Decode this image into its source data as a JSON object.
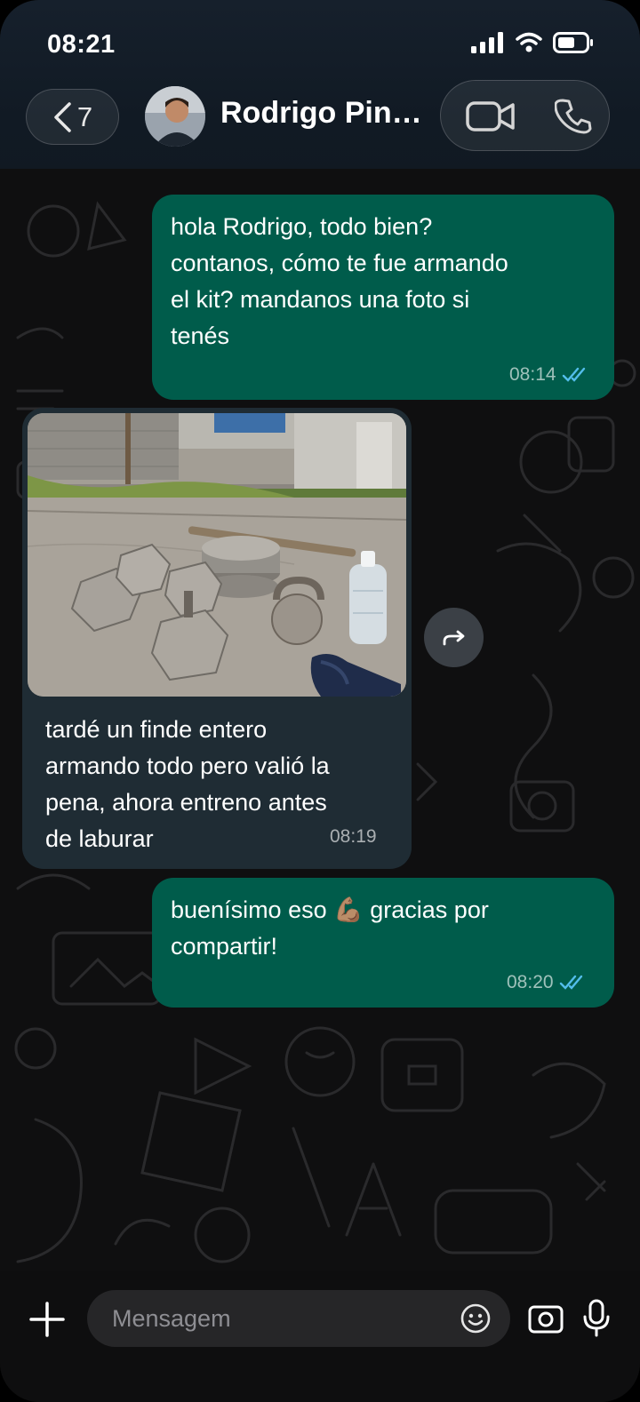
{
  "status_bar": {
    "time": "08:21",
    "icons": [
      "signal-icon",
      "wifi-icon",
      "battery-icon"
    ]
  },
  "header": {
    "back_count": "7",
    "contact_name": "Rodrigo Pin…",
    "actions": [
      "video-call-icon",
      "phone-call-icon"
    ]
  },
  "messages": [
    {
      "direction": "outgoing",
      "text": "hola Rodrigo, todo bien?\ncontanos, cómo te fue armando\nel kit? mandanos una foto si\ntenés",
      "time": "08:14",
      "status": "read"
    },
    {
      "direction": "incoming",
      "has_image": true,
      "image_subject": "homemade concrete weights, dumbbells and a kettlebell on a patio",
      "text": "tardé un finde entero\narmando todo pero valió la\npena, ahora entreno antes\nde laburar",
      "time": "08:19"
    },
    {
      "direction": "outgoing",
      "text_before": "buenísimo eso",
      "emoji": "💪🏽",
      "text_after": "gracias por\ncompartir!",
      "time": "08:20",
      "status": "read"
    }
  ],
  "composer": {
    "placeholder": "Mensagem"
  },
  "colors": {
    "outgoing_bubble": "#005c4b",
    "incoming_bubble": "#1f2c34",
    "read_ticks": "#53bdeb"
  }
}
